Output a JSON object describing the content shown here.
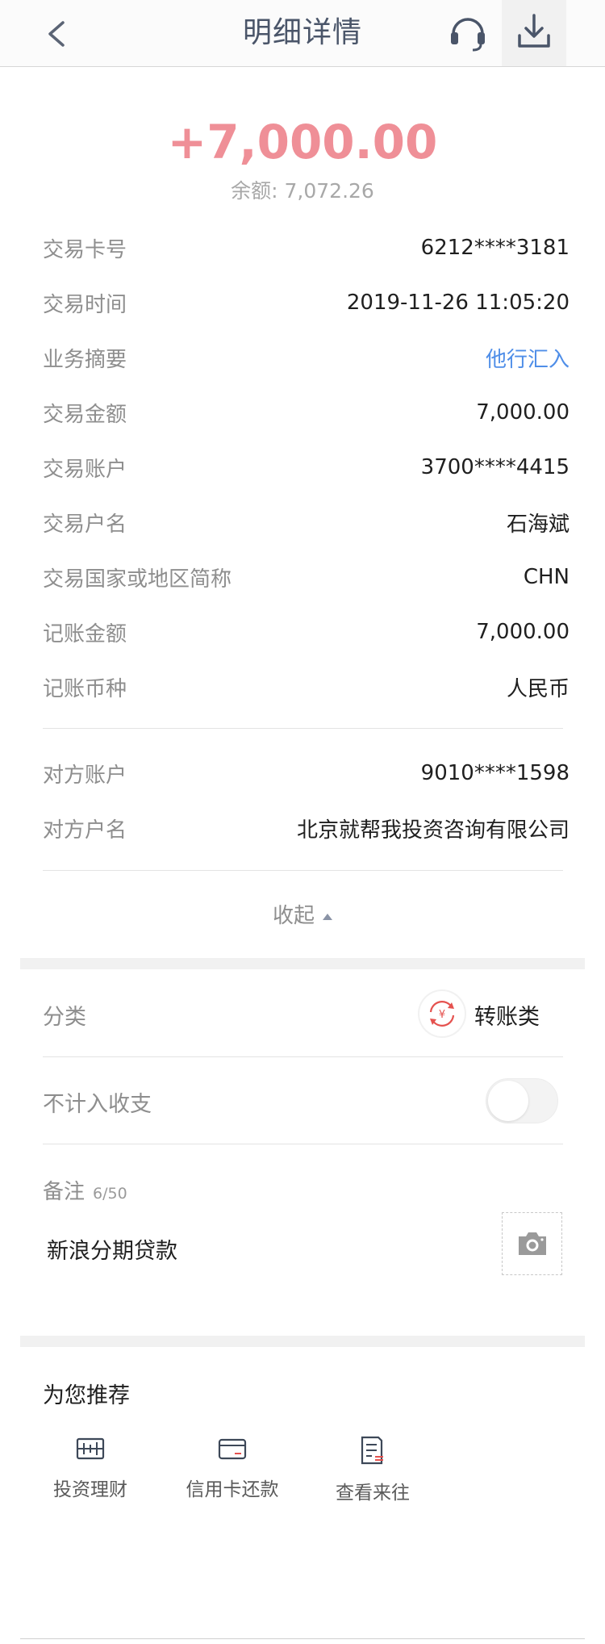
{
  "header": {
    "title": "明细详情",
    "back_icon": "chevron-left-icon",
    "service_icon": "headset-icon",
    "download_icon": "download-icon"
  },
  "summary": {
    "amount": "+7,000.00",
    "balance": "余额: 7,072.26"
  },
  "details": [
    {
      "label": "交易卡号",
      "value": "6212****3181"
    },
    {
      "label": "交易时间",
      "value": "2019-11-26 11:05:20"
    },
    {
      "label": "业务摘要",
      "value": "他行汇入"
    },
    {
      "label": "交易金额",
      "value": "7,000.00"
    },
    {
      "label": "交易账户",
      "value": "3700****4415"
    },
    {
      "label": "交易户名",
      "value": "石海斌"
    },
    {
      "label": "交易国家或地区简称",
      "value": "CHN"
    },
    {
      "label": "记账金额",
      "value": "7,000.00"
    },
    {
      "label": "记账币种",
      "value": "人民币"
    }
  ],
  "counterparty": [
    {
      "label": "对方账户",
      "value": "9010****1598"
    },
    {
      "label": "对方户名",
      "value": "北京就帮我投资咨询有限公司"
    }
  ],
  "collapse_label": "收起",
  "category": {
    "label": "分类",
    "value": "转账类",
    "icon": "transfer-icon"
  },
  "exclude": {
    "label": "不计入收支",
    "enabled": false
  },
  "note": {
    "label": "备注",
    "count": "6/50",
    "text": "新浪分期贷款",
    "camera_icon": "camera-icon"
  },
  "recommend": {
    "title": "为您推荐",
    "items": [
      {
        "label": "投资理财",
        "icon": "investment-icon"
      },
      {
        "label": "信用卡还款",
        "icon": "credit-card-icon"
      },
      {
        "label": "查看来往",
        "icon": "records-icon"
      }
    ]
  },
  "colors": {
    "amount": "#ef8f97",
    "link": "#4f8ee8",
    "category_accent": "#e5524f"
  }
}
